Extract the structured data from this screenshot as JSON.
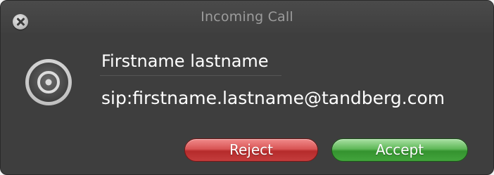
{
  "window": {
    "title": "Incoming Call"
  },
  "caller": {
    "name": "Firstname lastname",
    "uri": "sip:firstname.lastname@tandberg.com"
  },
  "buttons": {
    "reject_label": "Reject",
    "accept_label": "Accept"
  },
  "icons": {
    "close": "close-icon",
    "call": "call-target-icon"
  },
  "colors": {
    "window_bg": "#3e3e3e",
    "title_text": "#9c9c9c",
    "text": "#ffffff",
    "reject": "#c94242",
    "accept": "#46a640"
  }
}
